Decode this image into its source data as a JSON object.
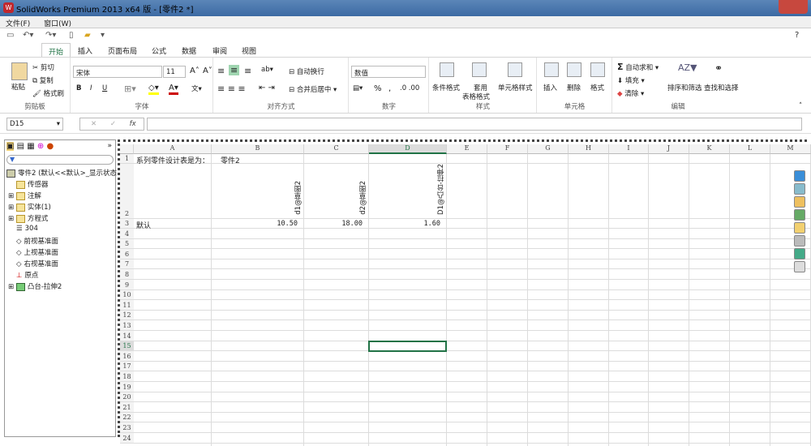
{
  "window": {
    "title": "SolidWorks Premium 2013 x64 版 - [零件2 *]"
  },
  "menu": [
    "文件(F)",
    "窗口(W)"
  ],
  "help": "?",
  "ribbon_tabs": [
    "开始",
    "插入",
    "页面布局",
    "公式",
    "数据",
    "审阅",
    "视图"
  ],
  "clipboard": {
    "paste": "粘贴",
    "cut": "剪切",
    "copy": "复制",
    "format_painter": "格式刷",
    "label": "剪贴板"
  },
  "font": {
    "name": "宋体",
    "size": "11",
    "label": "字体",
    "bold": "B",
    "italic": "I",
    "underline": "U"
  },
  "alignment": {
    "wrap": "自动换行",
    "merge": "合并后居中",
    "label": "对齐方式"
  },
  "number": {
    "format": "数值",
    "percent": "%",
    "comma": ",",
    "label": "数字"
  },
  "styles": {
    "conditional": "条件格式",
    "table_line1": "套用",
    "table_line2": "表格格式",
    "cell_styles": "单元格样式",
    "label": "样式"
  },
  "cells": {
    "insert": "插入",
    "delete": "删除",
    "format": "格式",
    "label": "单元格"
  },
  "editing": {
    "autosum": "自动求和",
    "fill": "填充",
    "clear": "清除",
    "sort": "排序和筛选",
    "find": "查找和选择",
    "label": "编辑"
  },
  "formula_bar": {
    "name_box": "D15",
    "fx": "fx",
    "cancel": "✕",
    "enter": "✓",
    "value": ""
  },
  "tree": {
    "root": "零件2  (默认<<默认>_显示状态",
    "items": [
      "传感器",
      "注解",
      "实体(1)",
      "方程式",
      "304",
      "前视基准面",
      "上视基准面",
      "右视基准面",
      "原点",
      "凸台-拉伸2"
    ]
  },
  "sheet": {
    "columns": [
      "A",
      "B",
      "C",
      "D",
      "E",
      "F",
      "G",
      "H",
      "I",
      "J",
      "K",
      "L",
      "M"
    ],
    "rows": [
      "1",
      "2",
      "3",
      "4",
      "5",
      "6",
      "7",
      "8",
      "9",
      "10",
      "11",
      "12",
      "13",
      "14",
      "15",
      "16",
      "17",
      "18",
      "19",
      "20",
      "21",
      "22",
      "23",
      "24"
    ],
    "a1": "系列零件设计表是为：",
    "b1": "零件2",
    "headers": [
      "d1@草图2",
      "d2@草图2",
      "D1@凸台-拉伸2"
    ],
    "a3": "默认",
    "values": [
      "10.50",
      "18.00",
      "1.60"
    ],
    "selected_cell": "D15"
  },
  "colors": {
    "accent": "#217346",
    "title_bar": "#4a78ad",
    "selection": "#217346"
  }
}
